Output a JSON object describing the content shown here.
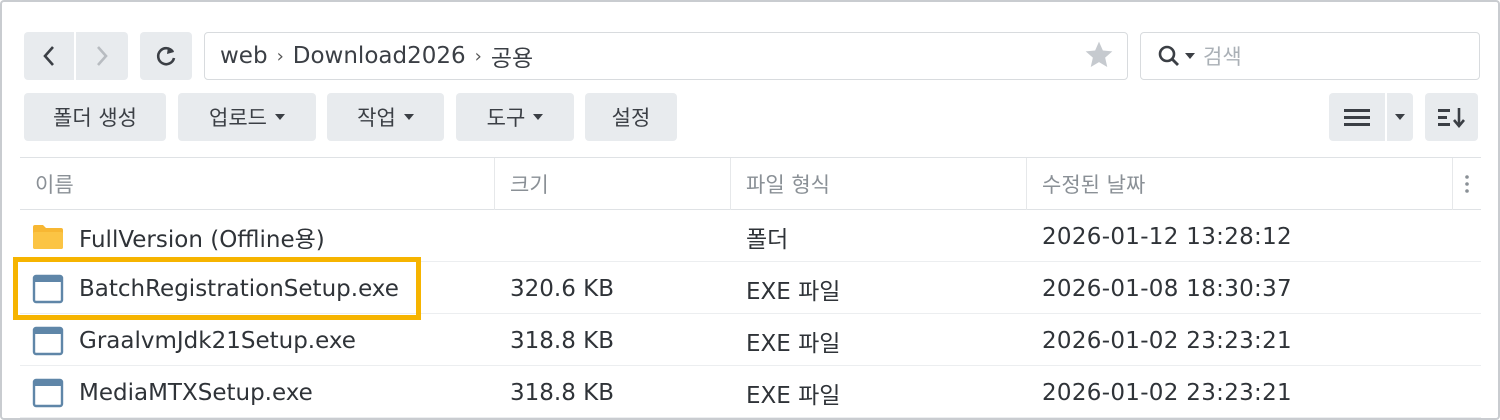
{
  "nav": {
    "back_icon": "chevron-left-icon",
    "forward_icon": "chevron-right-icon",
    "refresh_icon": "refresh-icon"
  },
  "path": {
    "crumbs": [
      "web",
      "Download2026",
      "공용"
    ],
    "separator": "›",
    "favorite_icon": "star-icon"
  },
  "search": {
    "placeholder": "검색",
    "icon": "search-icon"
  },
  "toolbar": {
    "create_folder": "폴더 생성",
    "upload": "업로드",
    "action": "작업",
    "tools": "도구",
    "settings": "설정"
  },
  "view": {
    "list_icon": "list-view-icon",
    "dropdown_icon": "caret-down-icon",
    "sort_icon": "sort-icon"
  },
  "table": {
    "headers": [
      "이름",
      "크기",
      "파일 형식",
      "수정된 날짜"
    ],
    "more_icon": "more-vertical-icon",
    "rows": [
      {
        "name": "FullVersion (Offline용)",
        "size": "",
        "type": "폴더",
        "modified": "2026-01-12 13:28:12",
        "icon": "folder-icon"
      },
      {
        "name": "BatchRegistrationSetup.exe",
        "size": "320.6 KB",
        "type": "EXE 파일",
        "modified": "2026-01-08 18:30:37",
        "icon": "file-window-icon"
      },
      {
        "name": "GraalvmJdk21Setup.exe",
        "size": "318.8 KB",
        "type": "EXE 파일",
        "modified": "2026-01-02 23:23:21",
        "icon": "file-window-icon"
      },
      {
        "name": "MediaMTXSetup.exe",
        "size": "318.8 KB",
        "type": "EXE 파일",
        "modified": "2026-01-02 23:23:21",
        "icon": "file-window-icon"
      }
    ]
  },
  "colors": {
    "highlight": "#f6b400",
    "folder": "#f7b733",
    "button_bg": "#e8ebee"
  }
}
